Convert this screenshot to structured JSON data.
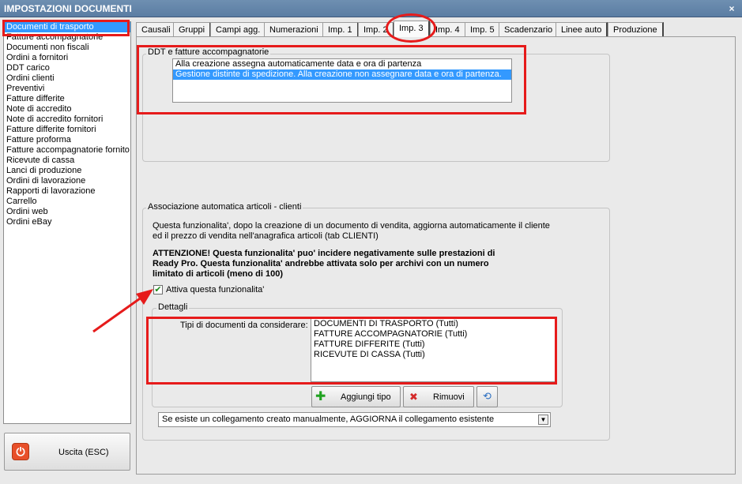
{
  "window": {
    "title": "IMPOSTAZIONI DOCUMENTI",
    "close_glyph": "×"
  },
  "sidebar": {
    "items": [
      "Documenti di trasporto",
      "Fatture accompagnatorie",
      "Documenti non fiscali",
      "Ordini a fornitori",
      "DDT carico",
      "Ordini clienti",
      "Preventivi",
      "Fatture differite",
      "Note di accredito",
      "Note di accredito fornitori",
      "Fatture differite fornitori",
      "Fatture proforma",
      "Fatture accompagnatorie fornito",
      "Ricevute di cassa",
      "Lanci di produzione",
      "Ordini di lavorazione",
      "Rapporti di lavorazione",
      "Carrello",
      "Ordini web",
      "Ordini eBay"
    ],
    "selected_index": 0
  },
  "exit_button": {
    "label": "Uscita (ESC)",
    "icon": "power-icon"
  },
  "tabs": [
    "Causali",
    "Gruppi",
    "Campi agg.",
    "Numerazioni",
    "Imp. 1",
    "Imp. 2",
    "Imp. 3",
    "Imp. 4",
    "Imp. 5",
    "Scadenzario",
    "Linee auto",
    "Produzione"
  ],
  "active_tab": "Imp. 3",
  "ddt_group": {
    "legend": "DDT e fatture accompagnatorie",
    "options": [
      "Alla creazione assegna automaticamente data e ora di partenza",
      "Gestione distinte di spedizione. Alla creazione non assegnare data e ora di partenza."
    ],
    "selected_index": 1
  },
  "assoc_group": {
    "legend": "Associazione automatica articoli - clienti",
    "description_line1": "Questa funzionalita', dopo la creazione di un documento di vendita, aggiorna automaticamente il cliente",
    "description_line2": "ed il prezzo di vendita nell'anagrafica articoli (tab CLIENTI)",
    "warning_line1": "ATTENZIONE! Questa funzionalita' puo' incidere negativamente sulle prestazioni di",
    "warning_line2": "Ready Pro. Questa funzionalita' andrebbe attivata solo per archivi con un numero",
    "warning_line3": "limitato di articoli (meno di 100)",
    "checkbox_label": "Attiva questa funzionalita'",
    "checkbox_checked": true,
    "checkmark": "✔",
    "details": {
      "legend": "Dettagli",
      "doc_types_label": "Tipi di documenti da considerare:",
      "doc_types": [
        "DOCUMENTI DI TRASPORTO (Tutti)",
        "FATTURE ACCOMPAGNATORIE (Tutti)",
        "FATTURE DIFFERITE (Tutti)",
        "RICEVUTE DI CASSA (Tutti)"
      ],
      "add_button": "Aggiungi tipo",
      "remove_button": "Rimuovi",
      "add_glyph": "✚",
      "remove_glyph": "✖",
      "clear_glyph": "⟲"
    },
    "link_mode_select": "Se esiste un collegamento creato manualmente, AGGIORNA il collegamento esistente"
  },
  "colors": {
    "highlight": "#e61b1b",
    "selection": "#3399ff",
    "titlebar": "#5b7da3"
  }
}
